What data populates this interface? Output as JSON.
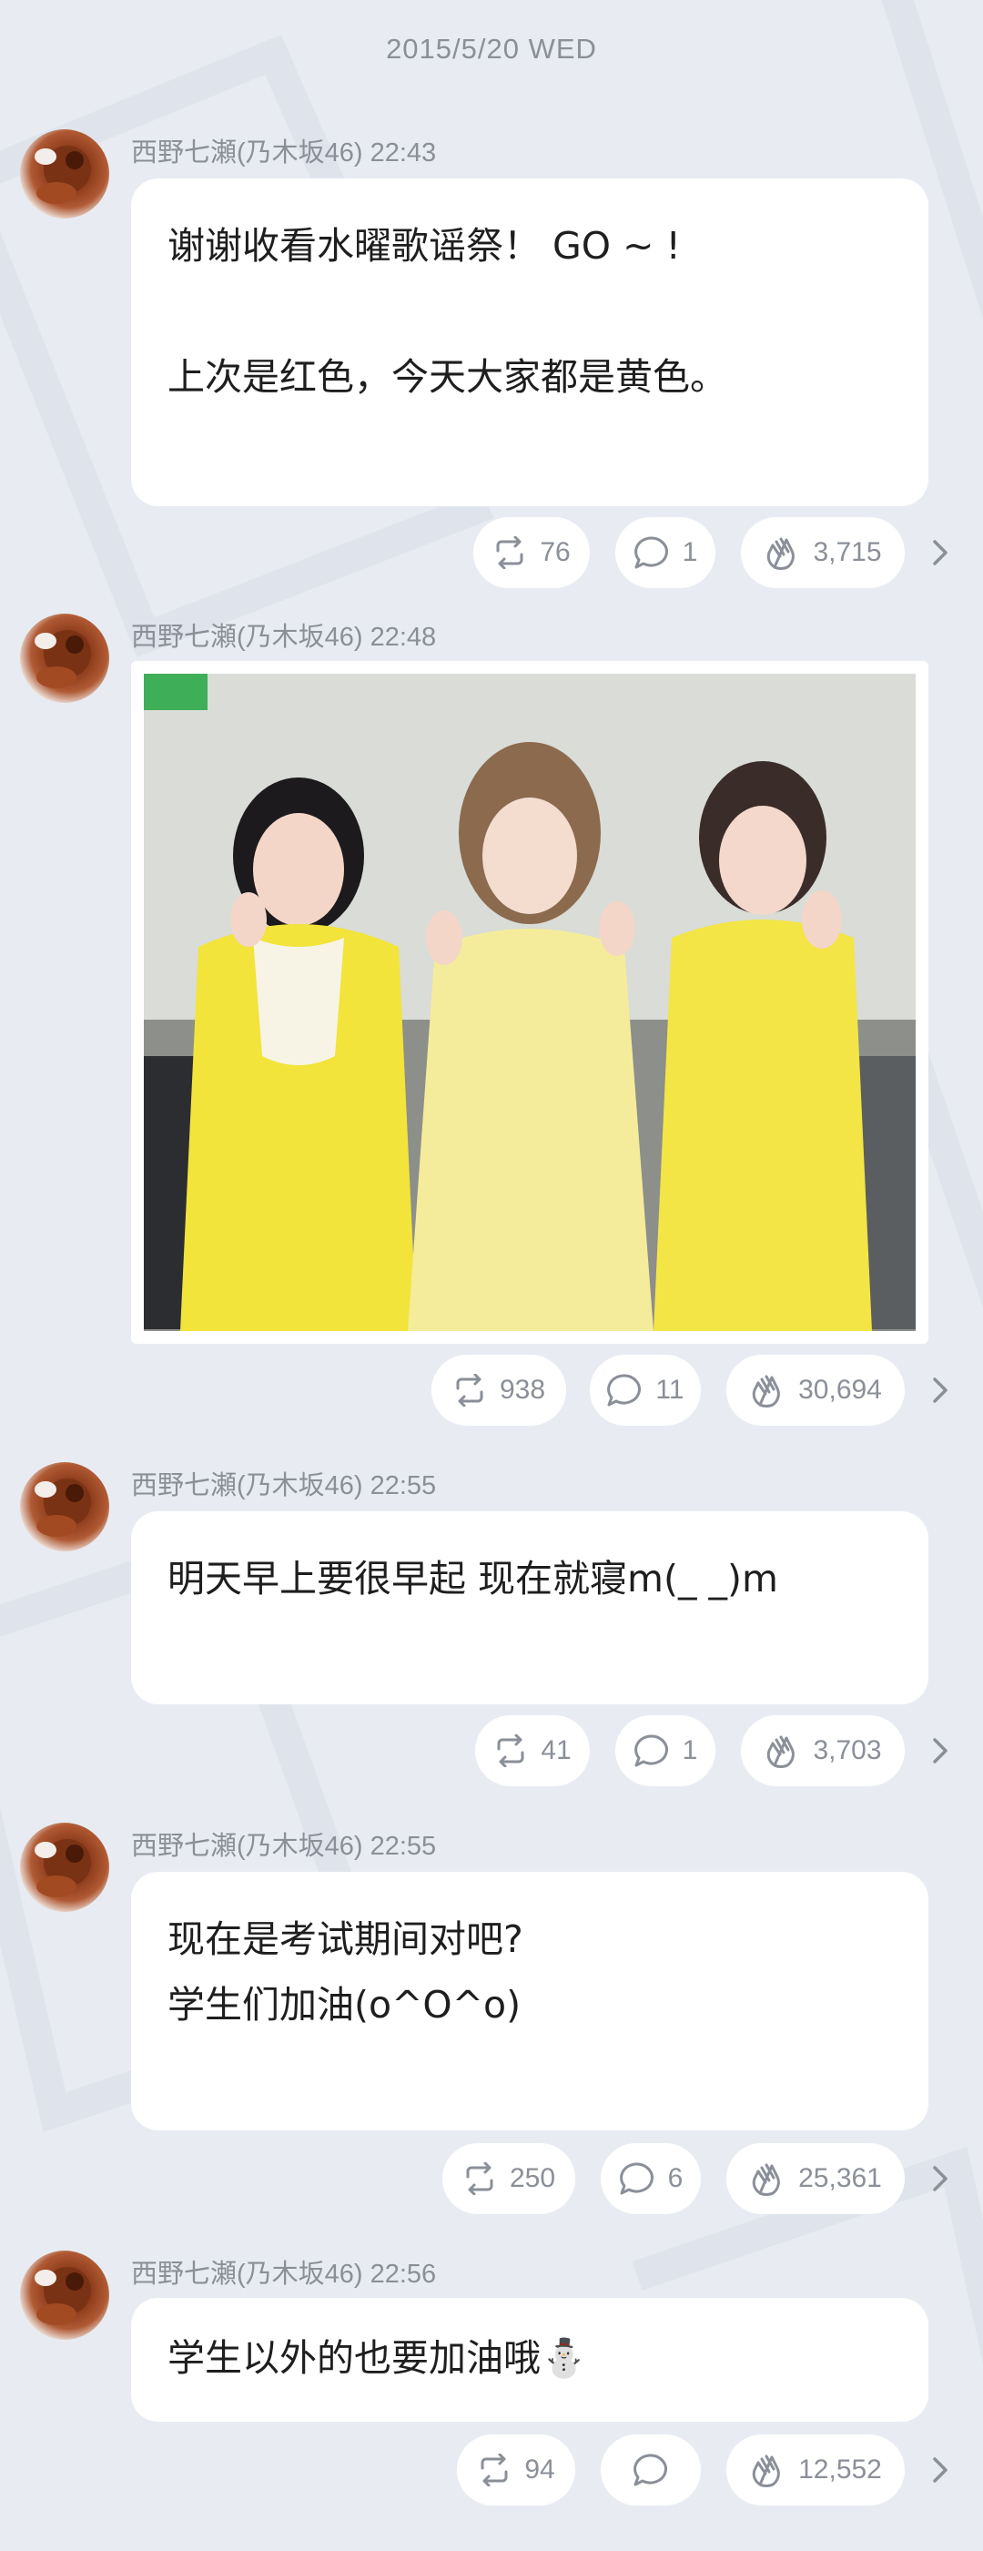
{
  "date_header": "2015/5/20 WED",
  "posts": [
    {
      "author": "西野七瀬(乃木坂46)",
      "time": "22:43",
      "text": "谢谢收看水曜歌谣祭！ GO ~ !\n\n上次是红色，今天大家都是黄色。",
      "reposts": "76",
      "comments": "1",
      "claps": "3,715"
    },
    {
      "author": "西野七瀬(乃木坂46)",
      "time": "22:48",
      "image": "photo-three-girls-yellow-dresses",
      "reposts": "938",
      "comments": "11",
      "claps": "30,694"
    },
    {
      "author": "西野七瀬(乃木坂46)",
      "time": "22:55",
      "text": "明天早上要很早起 现在就寝m(_ _)m",
      "reposts": "41",
      "comments": "1",
      "claps": "3,703"
    },
    {
      "author": "西野七瀬(乃木坂46)",
      "time": "22:55",
      "text": "现在是考试期间对吧?\n学生们加油(o^O^o)",
      "reposts": "250",
      "comments": "6",
      "claps": "25,361"
    },
    {
      "author": "西野七瀬(乃木坂46)",
      "time": "22:56",
      "text": "学生以外的也要加油哦⛄",
      "reposts": "94",
      "comments": "",
      "claps": "12,552"
    }
  ],
  "icons": {
    "repost": "repost-icon",
    "comment": "comment-icon",
    "clap": "clap-icon",
    "more": "chevron-right-icon"
  },
  "colors": {
    "background": "#e8ecf2",
    "bubble": "#ffffff",
    "meta_text": "#8a8f98"
  }
}
